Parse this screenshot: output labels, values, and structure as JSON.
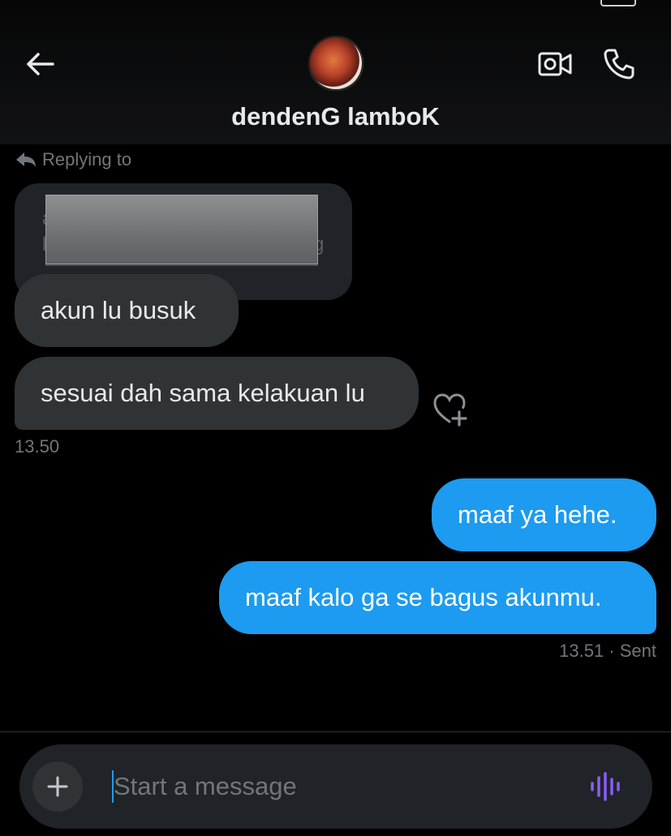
{
  "header": {
    "contact_name": "dendenG lamboK",
    "icons": {
      "back": "back-arrow-icon",
      "video": "video-call-icon",
      "call": "phone-icon"
    }
  },
  "conversation": {
    "reply_label": "Replying to",
    "quoted_fragments": {
      "line1": "a",
      "line2": "k",
      "line2_end": "g"
    },
    "received": [
      {
        "text": "akun lu busuk"
      },
      {
        "text": "sesuai dah sama kelakuan lu"
      }
    ],
    "received_time": "13.50",
    "sent": [
      {
        "text": "maaf ya hehe."
      },
      {
        "text": "maaf kalo ga se bagus akunmu."
      }
    ],
    "sent_status": "13.51 · Sent"
  },
  "composer": {
    "placeholder": "Start a message"
  },
  "colors": {
    "background": "#000000",
    "received_bubble": "#2f3336",
    "sent_bubble": "#1d9bf0",
    "muted_text": "#71767b",
    "voice_icon": "#8b5cf6"
  }
}
